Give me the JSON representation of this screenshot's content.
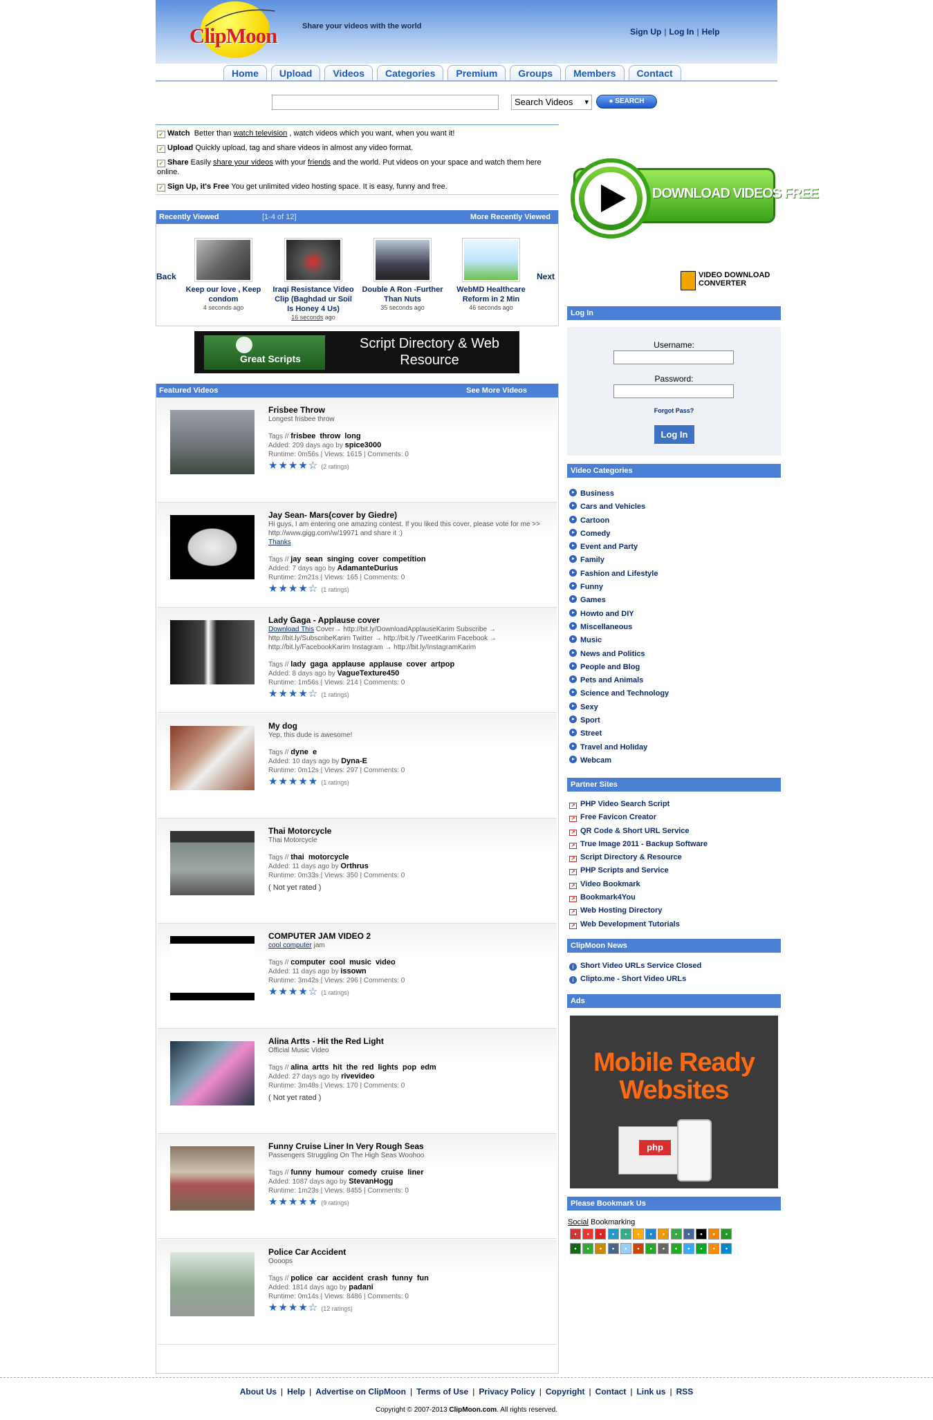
{
  "header": {
    "logo": "ClipMoon",
    "tagline": "Share your videos with the world",
    "links": [
      "Sign Up",
      "Log In",
      "Help"
    ]
  },
  "nav": {
    "tabs": [
      "Home",
      "Upload",
      "Videos",
      "Categories",
      "Premium",
      "Groups",
      "Members",
      "Contact"
    ]
  },
  "search": {
    "value": "",
    "select_value": "Search Videos",
    "button_label": "SEARCH"
  },
  "intro": [
    {
      "label": "Watch",
      "pre": "Better than",
      "link": "watch television",
      "post": ", watch videos which you want, when you want it!"
    },
    {
      "label": "Upload",
      "pre": "Quickly upload, tag and share videos in almost any video format.",
      "link": "",
      "post": ""
    },
    {
      "label": "Share",
      "pre": "Easily",
      "link": "share your videos",
      "mid": "with your",
      "link2": "friends",
      "post": "and the world. Put videos on your space and watch them here online."
    },
    {
      "label": "Sign Up, it's Free",
      "pre": "You get unlimited video hosting space. It is easy, funny and free.",
      "link": "",
      "post": ""
    }
  ],
  "recent": {
    "title": "Recently Viewed",
    "count": "[1-4 of 12]",
    "more": "More Recently Viewed",
    "back": "Back",
    "next": "Next",
    "items": [
      {
        "title": "Keep our love , Keep condom",
        "ago": "4 seconds ago"
      },
      {
        "title": "Iraqi Resistance Video Clip (Baghdad ur Soil Is Honey 4 Us)",
        "ago_link": "16 seconds",
        "ago": " ago"
      },
      {
        "title": "Double A Ron -Further Than Nuts",
        "ago": "35 seconds ago"
      },
      {
        "title": "WebMD Healthcare Reform in 2 Min",
        "ago": "46 seconds ago"
      }
    ]
  },
  "banner": {
    "left": "Great Scripts",
    "right": "Script Directory & Web Resource"
  },
  "featured": {
    "title": "Featured Videos",
    "more": "See More Videos",
    "videos": [
      {
        "title": "Frisbee Throw",
        "desc": "Longest frisbee throw",
        "tags": "frisbee  throw  long",
        "added": "209 days ago by",
        "user": "spice3000",
        "runtime": "0m56s",
        "views": "1615",
        "comments": "0",
        "rating": 4,
        "ratings": "(2 ratings)"
      },
      {
        "title": "Jay Sean- Mars(cover by Giedre)",
        "desc": "Hi guys, I am entering one amazing contest. If you liked this cover, please vote for me >> http://www.gigg.com/w/19971 and share it :)",
        "desc_link": "Thanks",
        "tags": "jay  sean  singing  cover  competition",
        "added": "7 days ago by",
        "user": "AdamanteDurius",
        "runtime": "2m21s",
        "views": "165",
        "comments": "0",
        "rating": 4,
        "ratings": "(1 ratings)"
      },
      {
        "title": "Lady Gaga - Applause cover",
        "desc_link": "Download This",
        "desc": " Cover→ http://bit.ly/DownloadApplauseKarim Subscribe → http://bit.ly/SubscribeKarim Twitter → http://bit.ly /TweetKarim Facebook → http://bit.ly/FacebookKarim Instagram → http://bit.ly/InstagramKarim",
        "tags": "lady  gaga  applause  applause  cover  artpop",
        "added": "8 days ago by",
        "user": "VagueTexture450",
        "runtime": "1m56s",
        "views": "214",
        "comments": "0",
        "rating": 4,
        "ratings": "(1 ratings)"
      },
      {
        "title": "My dog",
        "desc": "Yep, this dude is awesome!",
        "tags": "dyne  e",
        "added": "10 days ago by",
        "user": "Dyna-E",
        "runtime": "0m12s",
        "views": "297",
        "comments": "0",
        "rating": 5,
        "ratings": "(1 ratings)"
      },
      {
        "title": "Thai Motorcycle",
        "desc": "Thai Motorcycle",
        "tags": "thai  motorcycle",
        "added": "11 days ago by",
        "user": "Orthrus",
        "runtime": "0m33s",
        "views": "350",
        "comments": "0",
        "rating": 0,
        "ratings": "( Not yet rated )"
      },
      {
        "title": "COMPUTER JAM VIDEO 2",
        "desc_link": "cool computer",
        "desc": " jam",
        "tags": "computer  cool  music  video",
        "added": "11 days ago by",
        "user": "issown",
        "runtime": "3m42s",
        "views": "296",
        "comments": "0",
        "rating": 4,
        "ratings": "(1 ratings)"
      },
      {
        "title": "Alina Artts - Hit the Red Light",
        "desc": "Official Music Video",
        "tags": "alina  artts  hit  the  red  lights  pop  edm",
        "added": "27 days ago by",
        "user": "rivevideo",
        "runtime": "3m48s",
        "views": "170",
        "comments": "0",
        "rating": 0,
        "ratings": "( Not yet rated )"
      },
      {
        "title": "Funny Cruise Liner In Very Rough Seas",
        "desc": "Passengers Struggling On The High Seas Woohoo",
        "tags": "funny  humour  comedy  cruise  liner",
        "added": "1087 days ago by",
        "user": "StevanHogg",
        "runtime": "1m23s",
        "views": "8455",
        "comments": "0",
        "rating": 5,
        "ratings": "(9 ratings)"
      },
      {
        "title": "Police Car Accident",
        "desc": "Oooops",
        "tags": "police  car  accident  crash  funny  fun",
        "added": "1814 days ago by",
        "user": "padani",
        "runtime": "0m14s",
        "views": "8486",
        "comments": "0",
        "rating": 4,
        "ratings": "(12 ratings)"
      }
    ]
  },
  "sidebar": {
    "download_button": "DOWNLOAD VIDEOS FREE",
    "converter": "VIDEO DOWNLOAD CONVERTER",
    "login": {
      "title": "Log In",
      "username_label": "Username:",
      "password_label": "Password:",
      "forgot": "Forgot Pass?",
      "button": "Log In"
    },
    "categories": {
      "title": "Video Categories",
      "items": [
        "Business",
        "Cars and Vehicles",
        "Cartoon",
        "Comedy",
        "Event and Party",
        "Family",
        "Fashion and Lifestyle",
        "Funny",
        "Games",
        "Howto and DIY",
        "Miscellaneous",
        "Music",
        "News and Politics",
        "People and Blog",
        "Pets and Animals",
        "Science and Technology",
        "Sexy",
        "Sport",
        "Street",
        "Travel and Holiday",
        "Webcam"
      ]
    },
    "partners": {
      "title": "Partner Sites",
      "items": [
        "PHP Video Search Script",
        "Free Favicon Creator",
        "QR Code & Short URL Service",
        "True Image 2011 - Backup Software",
        "Script Directory & Resource",
        "PHP Scripts and Service",
        "Video Bookmark",
        "Bookmark4You",
        "Web Hosting Directory",
        "Web Development Tutorials"
      ]
    },
    "news": {
      "title": "ClipMoon News",
      "items": [
        "Short Video URLs Service Closed",
        "Clipto.me - Short Video URLs"
      ]
    },
    "ads": {
      "title": "Ads",
      "ad_text": "Mobile Ready Websites",
      "ad_badge": "php"
    },
    "bookmark": {
      "title": "Please Bookmark Us",
      "social_link": "Social",
      "social_rest": " Bookmarking"
    }
  },
  "footer": {
    "links": [
      "About Us",
      "Help",
      "Advertise on ClipMoon",
      "Terms of Use",
      "Privacy Policy",
      "Copyright",
      "Contact",
      "Link us",
      "RSS"
    ],
    "copyright_pre": "Copyright © 2007-2013 ",
    "copyright_site": "ClipMoon.com",
    "copyright_post": ". All rights reserved."
  },
  "colors": {
    "section_bar": "#4a7fd4",
    "link": "#0a2a6e",
    "star": "#2063c0",
    "ad_text": "#ff6a13"
  }
}
